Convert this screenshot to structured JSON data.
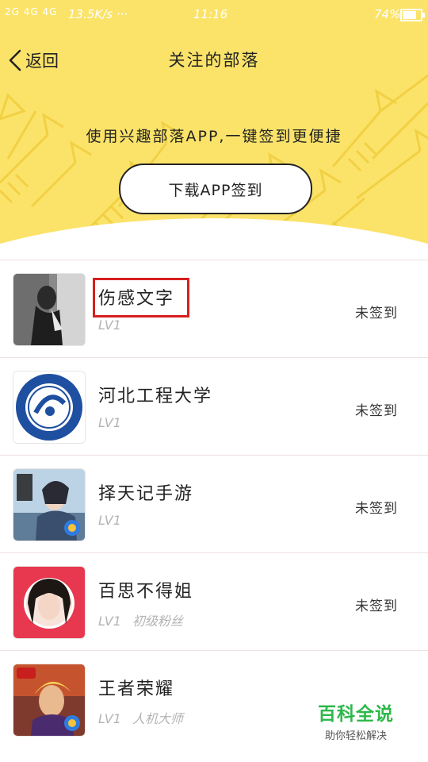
{
  "statusbar": {
    "signal": "2G 4G 4G",
    "speed": "13.5K/s ···",
    "time": "11:16",
    "battery_pct": "74%"
  },
  "navbar": {
    "back_label": "返回",
    "title": "关注的部落"
  },
  "promo": {
    "text": "使用兴趣部落APP,一键签到更便捷",
    "button_label": "下载APP签到"
  },
  "tribes": [
    {
      "name": "伤感文字",
      "level": "LV1",
      "rank": "",
      "status": "未签到"
    },
    {
      "name": "河北工程大学",
      "level": "LV1",
      "rank": "",
      "status": "未签到"
    },
    {
      "name": "择天记手游",
      "level": "LV1",
      "rank": "",
      "status": "未签到"
    },
    {
      "name": "百思不得姐",
      "level": "LV1",
      "rank": "初级粉丝",
      "status": "未签到"
    },
    {
      "name": "王者荣耀",
      "level": "LV1",
      "rank": "人机大师",
      "status": ""
    }
  ],
  "watermark": {
    "title": "百科全说",
    "subtitle": "助你轻松解决"
  },
  "colors": {
    "header_bg": "#fbe36a",
    "highlight_box": "#d81e1e",
    "watermark_green": "#2db84a"
  }
}
